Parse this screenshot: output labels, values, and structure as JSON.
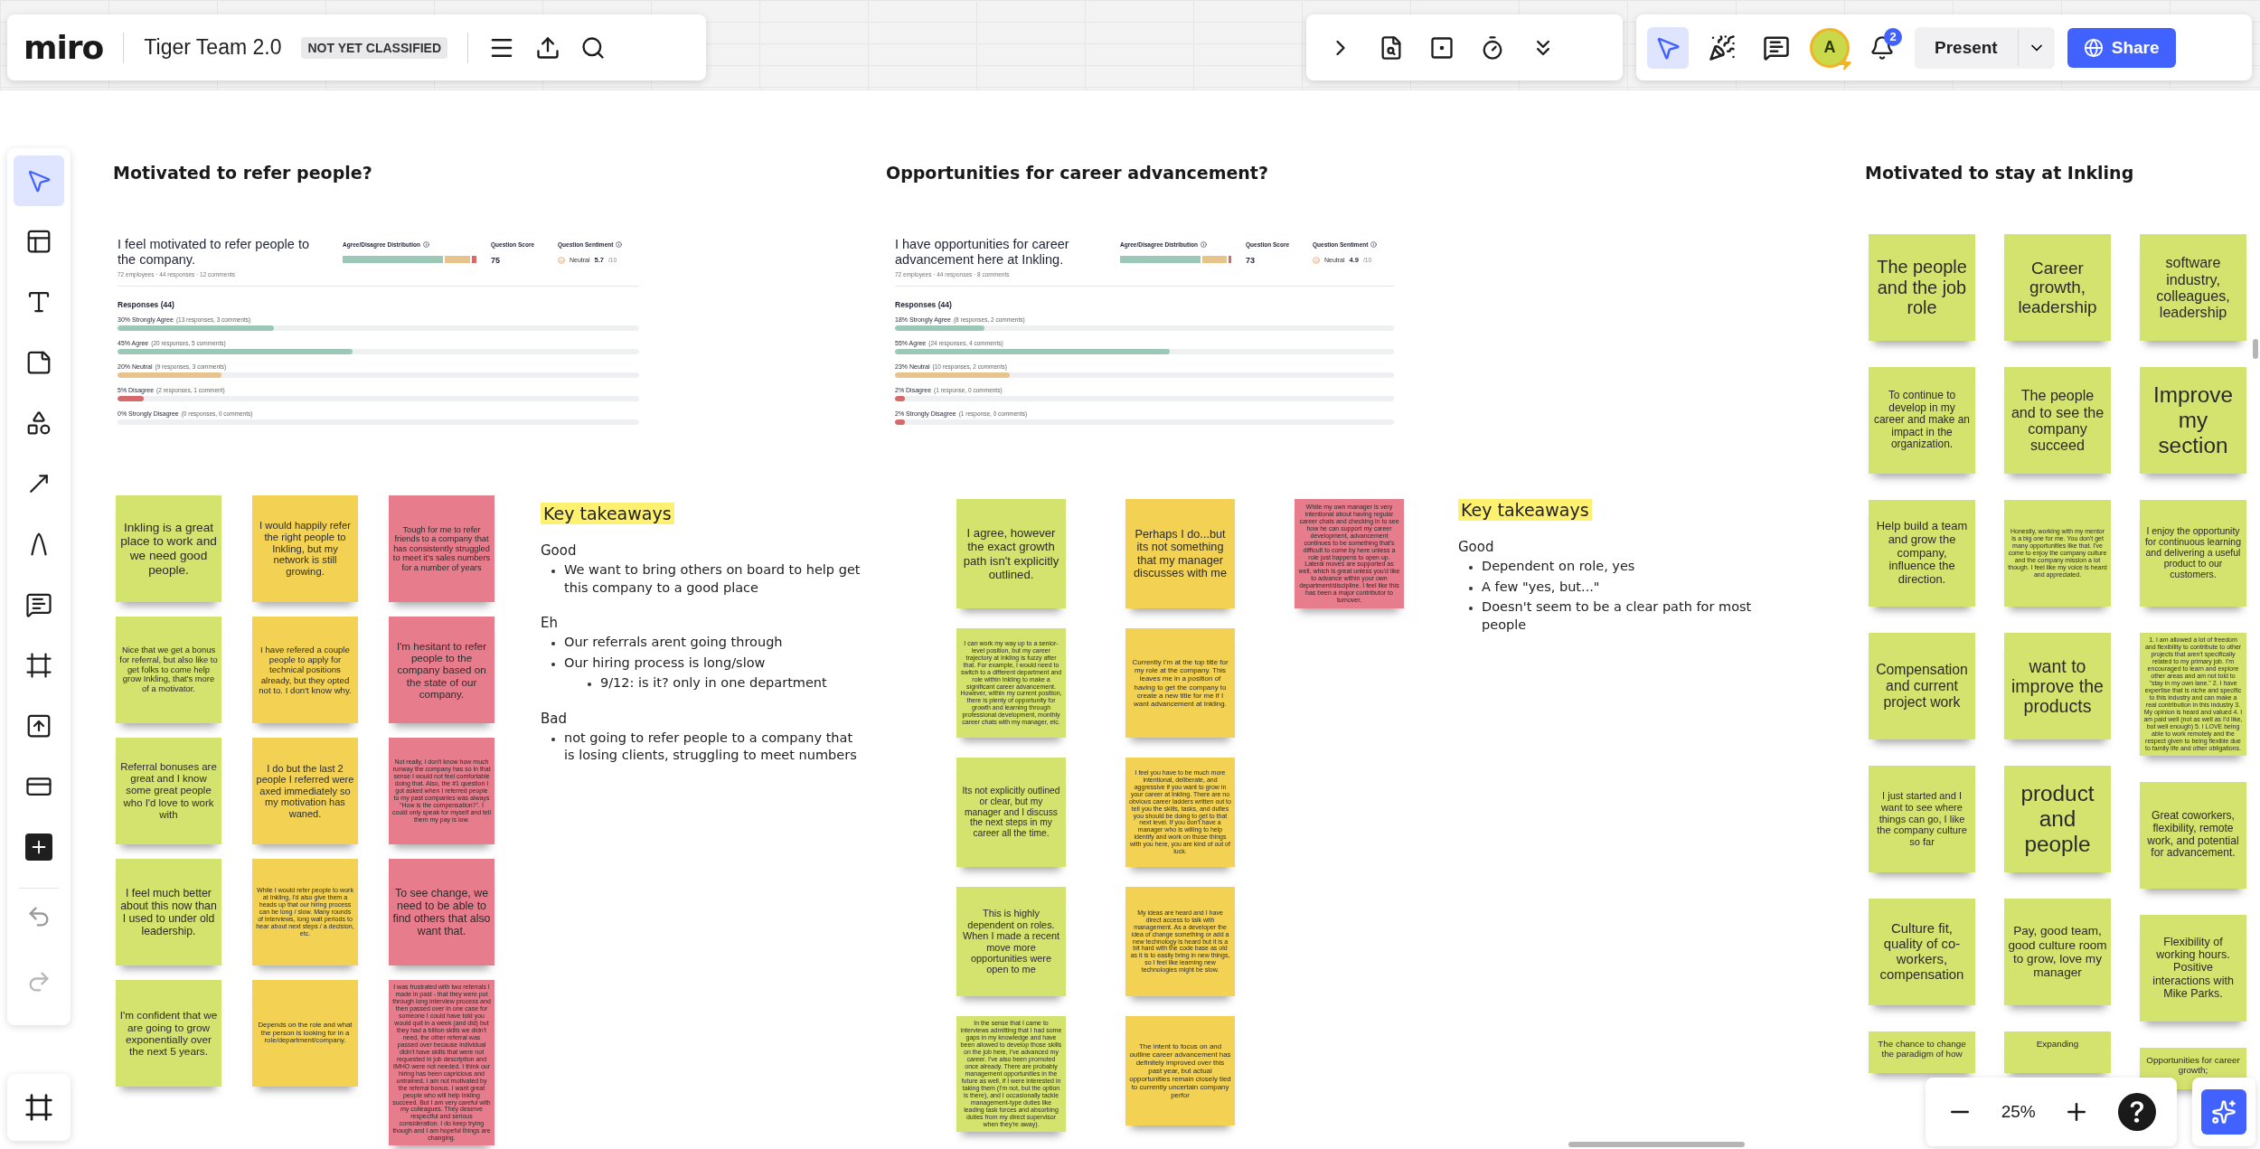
{
  "topbar": {
    "logo": "miro",
    "board_title": "Tiger Team 2.0",
    "classification": "NOT YET CLASSIFIED",
    "avatar": "A",
    "notifications": "2",
    "present": "Present",
    "share": "Share",
    "tools": [
      {
        "selected": false
      },
      {
        "selected": false
      },
      {
        "selected": false
      },
      {
        "selected": false
      },
      {
        "selected": false
      },
      {
        "selected": true
      },
      {
        "selected": false
      },
      {
        "selected": false
      }
    ]
  },
  "left_toolbar": {
    "tools": [
      {
        "selected": true
      },
      {
        "selected": false
      },
      {
        "selected": false
      },
      {
        "selected": false
      },
      {
        "selected": false
      },
      {
        "selected": false
      },
      {
        "selected": false
      },
      {
        "selected": false
      },
      {
        "selected": false
      },
      {
        "selected": false
      },
      {
        "selected": false
      },
      {
        "selected": false
      }
    ]
  },
  "sections": [
    {
      "title": "Motivated to refer people?",
      "survey": {
        "question": "I feel motivated to refer people to the company.",
        "meta": "72 employees · 44 responses · 12 comments",
        "distribution_label": "Agree/Disagree Distribution",
        "score_label": "Question Score",
        "score": "75",
        "sentiment_label": "Question Sentiment",
        "sentiment": "Neutral",
        "sentiment_value": "5.7",
        "sentiment_scale": "/10",
        "responses_title": "Responses (44)",
        "responses": [
          {
            "label": "30% Strongly Agree",
            "detail": "(13 responses, 3 comments)",
            "level": 0.3,
            "color": "#9cc8b8"
          },
          {
            "label": "45% Agree",
            "detail": "(20 responses, 5 comments)",
            "level": 0.45,
            "color": "#9cc8b8"
          },
          {
            "label": "20% Neutral",
            "detail": "(9 responses, 3 comments)",
            "level": 0.2,
            "color": "#e8c38c"
          },
          {
            "label": "5% Disagree",
            "detail": "(2 responses, 1 comment)",
            "level": 0.05,
            "color": "#d46a6a"
          },
          {
            "label": "0% Strongly Disagree",
            "detail": "(0 responses, 0 comments)"
          }
        ]
      },
      "columns": [
        {
          "notes": [
            {
              "text": "Inkling is a great place to work and we need good people.",
              "color": "#d4e26e"
            },
            {
              "text": "Nice that we get a bonus for referral, but also like to get folks to come help grow Inkling, that's more of a motivator.",
              "color": "#d4e26e"
            },
            {
              "text": "Referral bonuses are great and I know some great people who I'd love to work with",
              "color": "#d4e26e"
            },
            {
              "text": "I feel much better about this now than I used to under old leadership.",
              "color": "#d4e26e"
            },
            {
              "text": "I'm confident that we are going to grow exponentially over the next 5 years.",
              "color": "#d4e26e"
            }
          ]
        },
        {
          "notes": [
            {
              "text": "I would happily refer the right people to Inkling, but my network is still growing.",
              "color": "#f3d253"
            },
            {
              "text": "I have refered a couple people to apply for technical positions already, but they opted not to. I don't know why.",
              "color": "#f3d253"
            },
            {
              "text": "I do but the last 2 people I referred were axed immediately so my motivation has waned.",
              "color": "#f3d253"
            },
            {
              "text": "While I would refer people to work at Inkling, I'd also give them a heads up that our hiring process can be long / slow. Many rounds of interviews, long wait periods to hear about next steps / a decision, etc.",
              "color": "#f3d253"
            },
            {
              "text": "Depends on the role and what the person is looking for in a role/department/company.",
              "color": "#f3d253"
            }
          ]
        },
        {
          "notes": [
            {
              "text": "Tough for me to refer friends to a company that has consistently struggled to meet it's sales numbers for a number of years",
              "color": "#e77d8c"
            },
            {
              "text": "I'm hesitant to refer people to the company based on the state of our company.",
              "color": "#e77d8c"
            },
            {
              "text": "Not really, I don't know how much runway the company has so in that sense I would not feel comfortable doing that. Also, the #1 question I got asked when I referred people to my past companies was always \"How is the compensation?\". I could only speak for myself and tell them my pay is low.",
              "color": "#e77d8c"
            },
            {
              "text": "To see change, we need to be able to find others that also want that.",
              "color": "#e77d8c"
            },
            {
              "text": "I was frustrated with two referrals I made in past - that they were put through long interview process and then passed over in one case for someone I could have told you would quit in a week (and did) but they had a billion skills we didn't need, the other referral was passed over because individual didn't have skills that were not requested in job description and IMHO were not needed. I think our hiring has been capricious and untrained. I am not motivated by the referral bonus. I want great people who will help Inkling succeed. But I am very careful with my colleagues. They deserve respectful and serious consideration. I do keep trying though and I am hopeful things are changing.",
              "color": "#e77d8c"
            }
          ]
        }
      ],
      "takeaways": {
        "title": "Key takeaways",
        "groups": [
          {
            "heading": "Good",
            "items": [
              {
                "text": "We want to bring others on board to help get this company to a good place"
              }
            ]
          },
          {
            "heading": "Eh",
            "items": [
              {
                "text": "Our referrals arent going through"
              },
              {
                "text": "Our hiring process is long/slow",
                "children": [
                  {
                    "text": "9/12: is it? only in one department"
                  }
                ]
              }
            ]
          },
          {
            "heading": "Bad",
            "items": [
              {
                "text": "not going to refer people to a company that is losing clients, struggling to meet numbers"
              }
            ]
          }
        ]
      }
    },
    {
      "title": "Opportunities for career advancement?",
      "survey": {
        "question": "I have opportunities for career advancement here at Inkling.",
        "meta": "72 employees · 44 responses · 8 comments",
        "distribution_label": "Agree/Disagree Distribution",
        "score_label": "Question Score",
        "score": "73",
        "sentiment_label": "Question Sentiment",
        "sentiment": "Neutral",
        "sentiment_value": "4.9",
        "sentiment_scale": "/10",
        "responses_title": "Responses (44)",
        "responses": [
          {
            "label": "18% Strongly Agree",
            "detail": "(8 responses, 2 comments)",
            "level": 0.18,
            "color": "#9cc8b8"
          },
          {
            "label": "55% Agree",
            "detail": "(24 responses, 4 comments)",
            "level": 0.55,
            "color": "#9cc8b8"
          },
          {
            "label": "23% Neutral",
            "detail": "(10 responses, 2 comments)",
            "level": 0.23,
            "color": "#e8c38c"
          },
          {
            "label": "2% Disagree",
            "detail": "(1 response, 0 comments)",
            "level": 0.02,
            "color": "#d46a6a"
          },
          {
            "label": "2% Strongly Disagree",
            "detail": "(1 response, 0 comments)",
            "level": 0.02,
            "color": "#d46a6a"
          }
        ]
      },
      "columns": [
        {
          "notes": [
            {
              "text": "I agree, however the exact growth path isn't explicitly outlined.",
              "color": "#d4e26e"
            },
            {
              "text": "I can work my way up to a senior-level position, but my career trajectory at Inkling is fuzzy after that. For example, I would need to switch to a different department and role within Inkling to make a significant career advancement. However, within my current position, there is plenty of opportunity for growth and learning through professional development, monthly career chats with my manager, etc.",
              "color": "#d4e26e"
            },
            {
              "text": "Its not explicitly outlined or clear, but my manager and I discuss the next steps in my career all the time.",
              "color": "#d4e26e"
            },
            {
              "text": "This is highly dependent on roles. When I made a recent move more opportunities were open to me",
              "color": "#d4e26e"
            },
            {
              "text": "In the sense that I came to interviews admitting that I had some gaps in my knowledge and have been allowed to develop those skills on the job here, I've advanced my career. I've also been promoted once already. There are probably management opportunities in the future as well, if I were interested in taking them (I'm not, but the option is there), and I occasionally tackle management-type duties like leading task forces and absorbing duties from my direct supervisor when they're away).",
              "color": "#d4e26e"
            }
          ]
        },
        {
          "notes": [
            {
              "text": "Perhaps I do...but its not something that my manager discusses with me",
              "color": "#f3d253"
            },
            {
              "text": "Currently I'm at the top title for my role at the company. This leaves me in a position of having to get the company to create a new title for me if I want advancement at Inkling.",
              "color": "#f3d253"
            },
            {
              "text": "I feel you have to be much more intentional, deliberate, and aggressive if you want to grow in your career at Inkling. There are no obvious career ladders written out to tell you the skills, tasks, and duties you should be doing to get to that next level. If you don't have a manager who is willing to help identify and work on those things with you here, you are kind of out of luck.",
              "color": "#f3d253"
            },
            {
              "text": "My ideas are heard and I have direct access to talk with management. As a developer the idea of change something or add a new technology is heard but it is a bit hard with the code base as old as it is to easily bring in new things, so I feel like learning new technologies might be slow.",
              "color": "#f3d253"
            },
            {
              "text": "The intent to focus on and outline career advancement has definitely improved over this past year, but actual opportunities remain closely tied to currently uncertain company perfor",
              "color": "#f3d253"
            }
          ]
        },
        {
          "notes": [
            {
              "text": "While my own manager is very intentional about having regular career chats and checking in to see how he can support my career development, advancement continues to be something that's difficult to come by here unless a role just happens to open up. Lateral moves are supported as well, which is great unless you'd like to advance within your own department/discipline. I feel like this has been a major contributor to turnover.",
              "color": "#e77d8c"
            }
          ]
        }
      ],
      "takeaways": {
        "title": "Key takeaways",
        "groups": [
          {
            "heading": "Good",
            "items": [
              {
                "text": "Dependent on role, yes"
              },
              {
                "text": "A few \"yes, but...\""
              },
              {
                "text": "Doesn't seem to be a clear path for most people"
              }
            ]
          }
        ]
      }
    },
    {
      "title": "Motivated to stay at Inkling",
      "columns": [
        {
          "notes": [
            {
              "text": "The people and the job role",
              "color": "#d4e26e"
            },
            {
              "text": "To continue to develop in my career and make an impact in the organization.",
              "color": "#d4e26e"
            },
            {
              "text": "Help build a team and grow the company, influence the direction.",
              "color": "#d4e26e"
            },
            {
              "text": "Compensation and current project work",
              "color": "#d4e26e"
            },
            {
              "text": "I just started and I want to see where things can go, I like the company culture so far",
              "color": "#d4e26e"
            },
            {
              "text": "Culture fit, quality of co-workers, compensation",
              "color": "#d4e26e"
            },
            {
              "text": "The chance to change the paradigm of how",
              "color": "#d4e26e",
              "kind": "covered"
            }
          ]
        },
        {
          "notes": [
            {
              "text": "Career growth, leadership",
              "color": "#d4e26e"
            },
            {
              "text": "The people and to see the company succeed",
              "color": "#d4e26e"
            },
            {
              "text": "Honestly, working with my mentor is a big one for me. You don't get many opportunities like that. I've come to enjoy the company culture and the company mission a lot though. I feel like my voice is heard and appreciated.",
              "color": "#d4e26e"
            },
            {
              "text": "want to improve the products",
              "color": "#d4e26e"
            },
            {
              "text": "product and people",
              "color": "#d4e26e"
            },
            {
              "text": "Pay, good team, good culture room to grow, love my manager",
              "color": "#d4e26e"
            },
            {
              "text": "Expanding",
              "color": "#d4e26e",
              "kind": "covered"
            }
          ]
        },
        {
          "notes": [
            {
              "text": "software industry, colleagues, leadership",
              "color": "#d4e26e"
            },
            {
              "text": "Improve my section",
              "color": "#d4e26e"
            },
            {
              "text": "I enjoy the opportunity for continuous learning and delivering a useful product to our customers.",
              "color": "#d4e26e"
            },
            {
              "text": "1. I am allowed a lot of freedom and flexibility to contribute to other projects that aren't specifically related to my primary job. I'm encouraged to learn and explore other areas and am not told to \"stay in my own lane.\" 2. I have expertise that is niche and specific to this industry and can make a real contribution in this industry 3. My opinion is heard and valued 4. I am paid well (not as well as I'd like, but well enough) 5. I LOVE being able to work remotely and the respect given to being flexible due to family life and other obligations.",
              "color": "#d4e26e"
            },
            {
              "text": "Great coworkers, flexibility, remote work, and potential for advancement.",
              "color": "#d4e26e"
            },
            {
              "text": "Flexibility of working hours. Positive interactions with Mike Parks.",
              "color": "#d4e26e"
            },
            {
              "text": "Opportunities for career growth;",
              "color": "#d4e26e",
              "kind": "covered"
            }
          ]
        }
      ]
    }
  ],
  "zoom": {
    "value": "25%"
  }
}
